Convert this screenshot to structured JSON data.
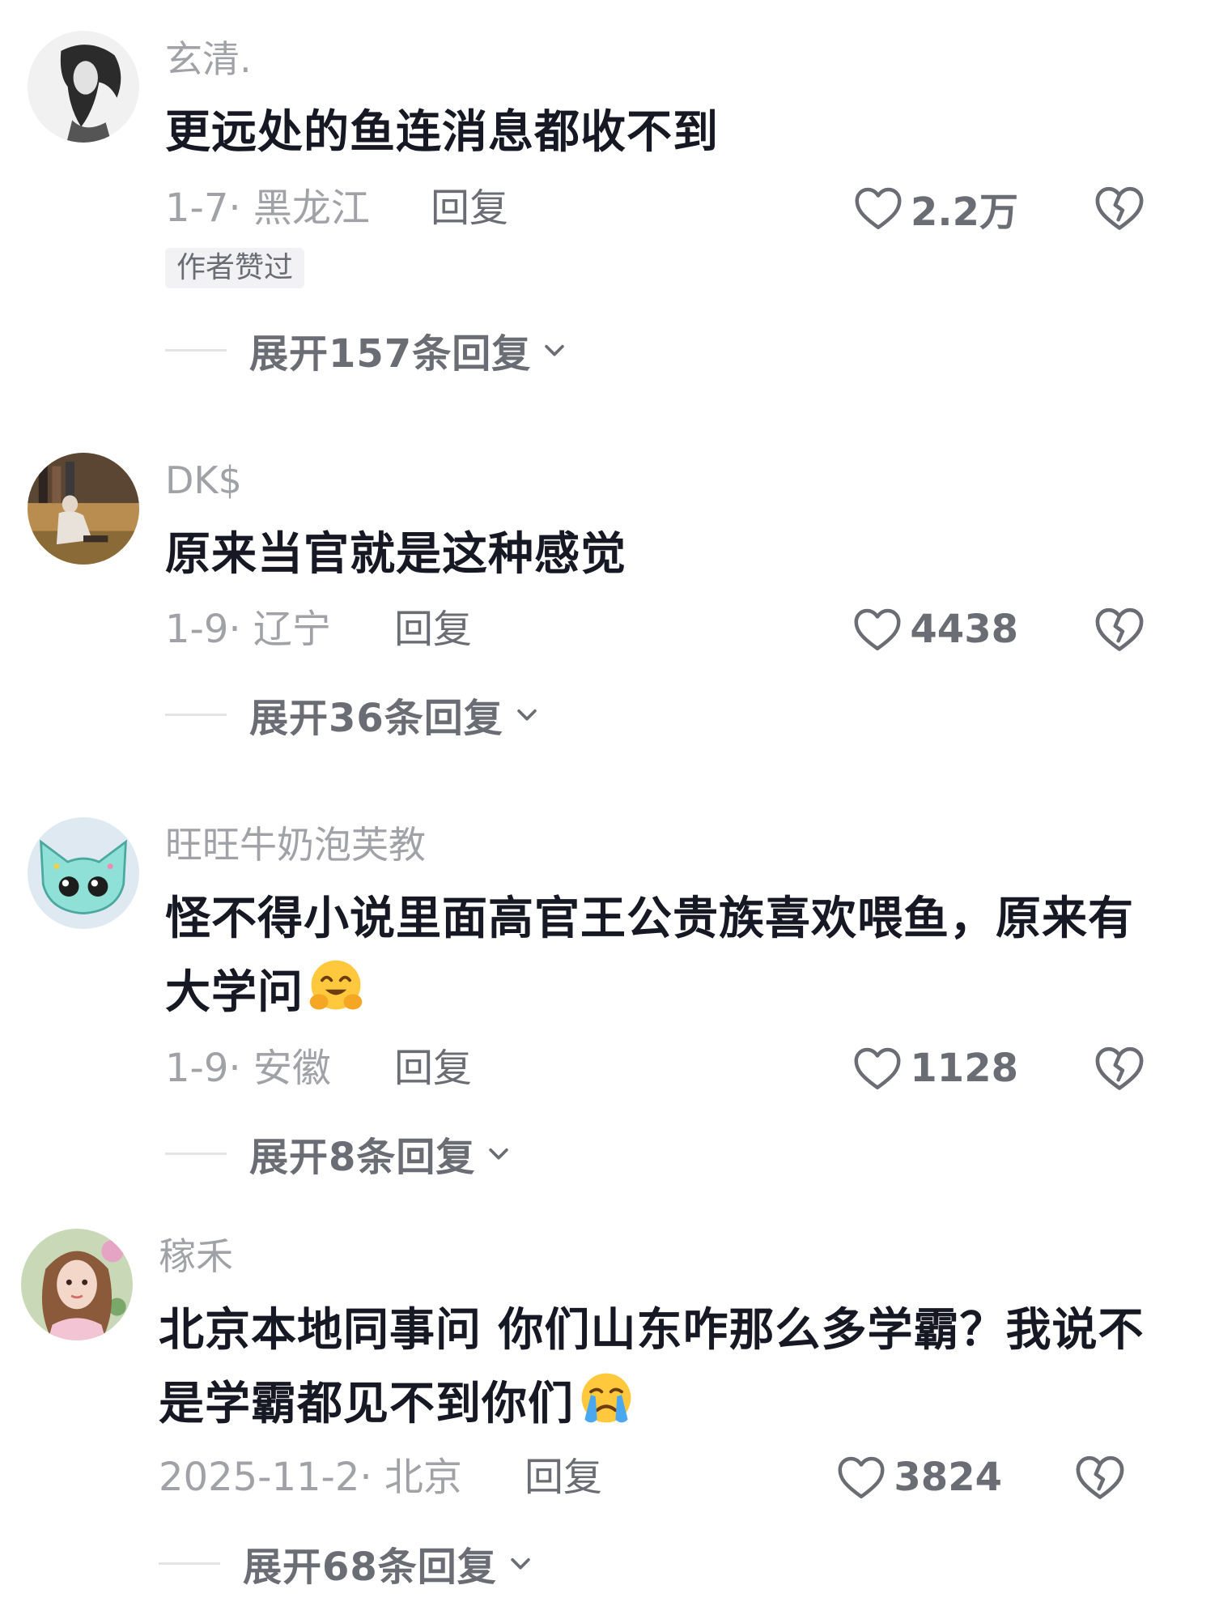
{
  "comments": [
    {
      "username": "玄清.",
      "text": "更远处的鱼连消息都收不到",
      "date_location": "1-7· 黑龙江",
      "reply_label": "回复",
      "likes": "2.2万",
      "badge": "作者赞过",
      "expand_label": "展开157条回复"
    },
    {
      "username": "DK$",
      "text": "原来当官就是这种感觉",
      "date_location": "1-9· 辽宁",
      "reply_label": "回复",
      "likes": "4438",
      "expand_label": "展开36条回复"
    },
    {
      "username": "旺旺牛奶泡芙教",
      "text": "怪不得小说里面高官王公贵族喜欢喂鱼，原来有大学问",
      "emoji": "hugging-face-emoji",
      "date_location": "1-9· 安徽",
      "reply_label": "回复",
      "likes": "1128",
      "expand_label": "展开8条回复"
    },
    {
      "username": "稼禾",
      "text": "北京本地同事问 你们山东咋那么多学霸？我说不是学霸都见不到你们",
      "emoji": "crying-face-emoji",
      "date_location": "2025-11-2· 北京",
      "reply_label": "回复",
      "likes": "3824",
      "expand_label": "展开68条回复"
    }
  ],
  "icons": {
    "like": "heart-outline-icon",
    "dislike": "broken-heart-icon",
    "expand": "chevron-down-icon"
  },
  "colors": {
    "text": "#161823",
    "muted": "#a0a2a8",
    "secondary": "#6b6d75",
    "badge_bg": "#f2f2f4",
    "emoji": "#ffc83d"
  }
}
